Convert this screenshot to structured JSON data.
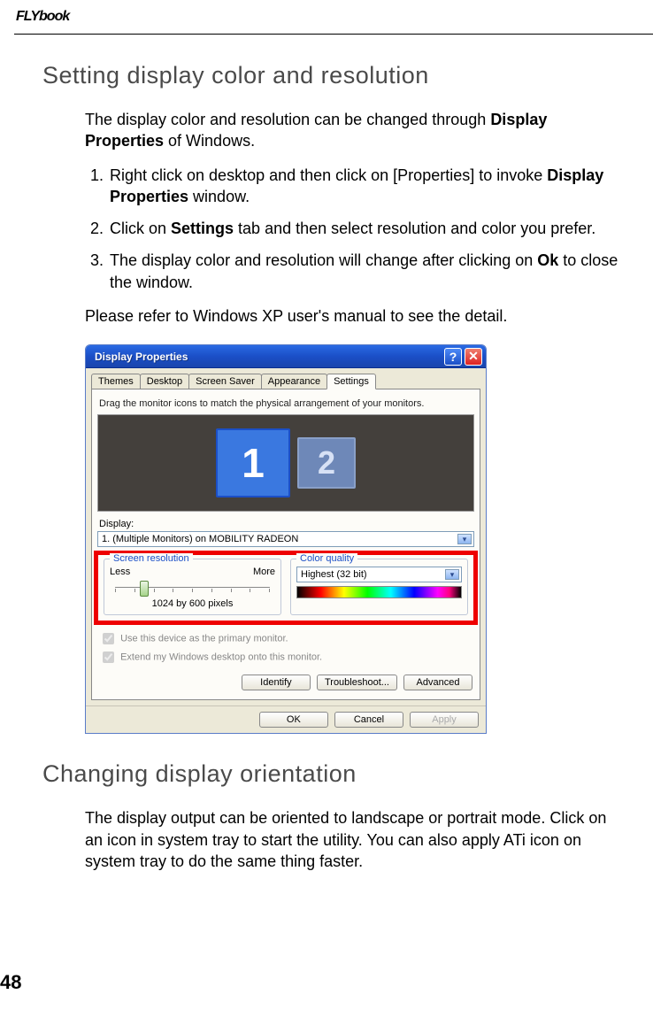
{
  "brand": "FLYbook",
  "page_number": "48",
  "section1": {
    "heading": "Setting display color and resolution",
    "intro_pre": "The display color and resolution can be changed through ",
    "intro_bold": "Display Properties",
    "intro_post": " of Windows.",
    "steps": {
      "s1_pre": "Right click on desktop and then click on [Properties] to invoke ",
      "s1_bold": "Display Properties",
      "s1_post": " window.",
      "s2_pre": "Click on ",
      "s2_bold": "Settings",
      "s2_post": " tab and then select resolution and color you prefer.",
      "s3_pre": "The display color and resolution will change after clicking on ",
      "s3_bold": "Ok",
      "s3_post": " to close the window."
    },
    "note": "Please refer to Windows XP user's manual to see the detail."
  },
  "dialog": {
    "title": "Display Properties",
    "help_glyph": "?",
    "close_glyph": "✕",
    "tabs": [
      "Themes",
      "Desktop",
      "Screen Saver",
      "Appearance",
      "Settings"
    ],
    "active_tab_index": 4,
    "instruction": "Drag the monitor icons to match the physical arrangement of your monitors.",
    "monitor1": "1",
    "monitor2": "2",
    "display_label": "Display:",
    "display_value": "1. (Multiple Monitors) on MOBILITY RADEON",
    "res_legend": "Screen resolution",
    "res_less": "Less",
    "res_more": "More",
    "res_current": "1024 by 600 pixels",
    "cq_legend": "Color quality",
    "cq_value": "Highest (32 bit)",
    "chk_primary": "Use this device as the primary monitor.",
    "chk_extend": "Extend my Windows desktop onto this monitor.",
    "btn_identify": "Identify",
    "btn_troubleshoot": "Troubleshoot...",
    "btn_advanced": "Advanced",
    "btn_ok": "OK",
    "btn_cancel": "Cancel",
    "btn_apply": "Apply"
  },
  "section2": {
    "heading": "Changing display orientation",
    "body": "The display output can be oriented to landscape or portrait mode. Click on an icon in system tray to start the utility. You can also apply ATi icon on system tray to do the same thing faster."
  },
  "chart_data": {
    "type": "table",
    "title": "Display Properties — Settings tab values",
    "rows": [
      {
        "field": "Display",
        "value": "1. (Multiple Monitors) on MOBILITY RADEON"
      },
      {
        "field": "Screen resolution",
        "value": "1024 by 600 pixels"
      },
      {
        "field": "Color quality",
        "value": "Highest (32 bit)"
      }
    ]
  }
}
